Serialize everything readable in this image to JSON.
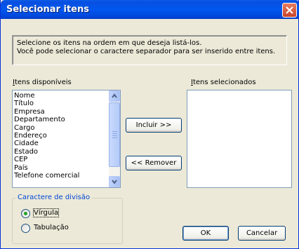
{
  "window": {
    "title": "Selecionar itens"
  },
  "info": {
    "line1": "Selecione os itens na ordem em que deseja listá-los.",
    "line2": "Você pode selecionar o caractere separador para ser inserido entre itens."
  },
  "available": {
    "label": "Itens disponíveis",
    "label_access_key": "I",
    "items": [
      "Nome",
      "Título",
      "Empresa",
      "Departamento",
      "Cargo",
      "Endereço",
      "Cidade",
      "Estado",
      "CEP",
      "País",
      "Telefone comercial"
    ]
  },
  "selected": {
    "label": "Itens selecionados",
    "label_access_key": "I",
    "items": []
  },
  "buttons": {
    "include": "Incluir >>",
    "remove": "<< Remover",
    "ok": "OK",
    "cancel": "Cancelar"
  },
  "separator": {
    "group_title": "Caractere de divisão",
    "options": [
      {
        "label": "Vírgula",
        "selected": true
      },
      {
        "label": "Tabulação",
        "selected": false
      }
    ]
  },
  "colors": {
    "titlebar": "#0058EE",
    "dialog_bg": "#ECE9D8",
    "group_title": "#0046D5",
    "radio_dot": "#21A121"
  },
  "icons": {
    "close": "close-x-icon",
    "scroll_up": "chevron-up-icon",
    "scroll_down": "chevron-down-icon"
  }
}
